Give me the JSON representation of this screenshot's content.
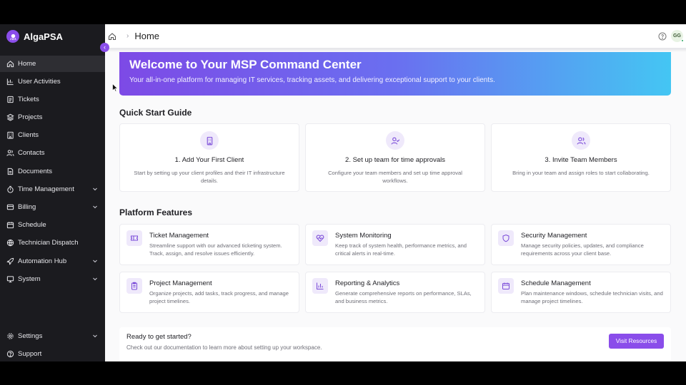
{
  "app": {
    "name": "AlgaPSA"
  },
  "header": {
    "breadcrumb_title": "Home",
    "user_initials": "GG"
  },
  "sidebar": {
    "items": [
      {
        "label": "Home",
        "icon": "home-icon"
      },
      {
        "label": "User Activities",
        "icon": "activity-icon"
      },
      {
        "label": "Tickets",
        "icon": "ticket-icon"
      },
      {
        "label": "Projects",
        "icon": "layers-icon"
      },
      {
        "label": "Clients",
        "icon": "building-icon"
      },
      {
        "label": "Contacts",
        "icon": "users-icon"
      },
      {
        "label": "Documents",
        "icon": "document-icon"
      },
      {
        "label": "Time Management",
        "icon": "timer-icon"
      },
      {
        "label": "Billing",
        "icon": "credit-card-icon"
      },
      {
        "label": "Schedule",
        "icon": "calendar-icon"
      },
      {
        "label": "Technician Dispatch",
        "icon": "globe-icon"
      },
      {
        "label": "Automation Hub",
        "icon": "rocket-icon"
      },
      {
        "label": "System",
        "icon": "monitor-icon"
      }
    ],
    "bottom_items": [
      {
        "label": "Settings",
        "icon": "gear-icon"
      },
      {
        "label": "Support",
        "icon": "help-icon"
      }
    ]
  },
  "hero": {
    "title": "Welcome to Your MSP Command Center",
    "subtitle": "Your all-in-one platform for managing IT services, tracking assets, and delivering exceptional support to your clients."
  },
  "quick_start": {
    "heading": "Quick Start Guide",
    "cards": [
      {
        "title": "1. Add Your First Client",
        "desc": "Start by setting up your client profiles and their IT infrastructure details."
      },
      {
        "title": "2. Set up team for time approvals",
        "desc": "Configure your team members and set up time approval workflows."
      },
      {
        "title": "3. Invite Team Members",
        "desc": "Bring in your team and assign roles to start collaborating."
      }
    ]
  },
  "features": {
    "heading": "Platform Features",
    "cards": [
      {
        "title": "Ticket Management",
        "desc": "Streamline support with our advanced ticketing system. Track, assign, and resolve issues efficiently."
      },
      {
        "title": "System Monitoring",
        "desc": "Keep track of system health, performance metrics, and critical alerts in real-time."
      },
      {
        "title": "Security Management",
        "desc": "Manage security policies, updates, and compliance requirements across your client base."
      },
      {
        "title": "Project Management",
        "desc": "Organize projects, add tasks, track progress, and manage project timelines."
      },
      {
        "title": "Reporting & Analytics",
        "desc": "Generate comprehensive reports on performance, SLAs, and business metrics."
      },
      {
        "title": "Schedule Management",
        "desc": "Plan maintenance windows, schedule technician visits, and manage project timelines."
      }
    ]
  },
  "cta": {
    "title": "Ready to get started?",
    "desc": "Check out our documentation to learn more about setting up your workspace.",
    "button": "Visit Resources"
  },
  "colors": {
    "accent": "#8a4dea",
    "sidebar_bg": "#1b1b1f",
    "hero_start": "#7d4ae6",
    "hero_end": "#44c6f3"
  }
}
